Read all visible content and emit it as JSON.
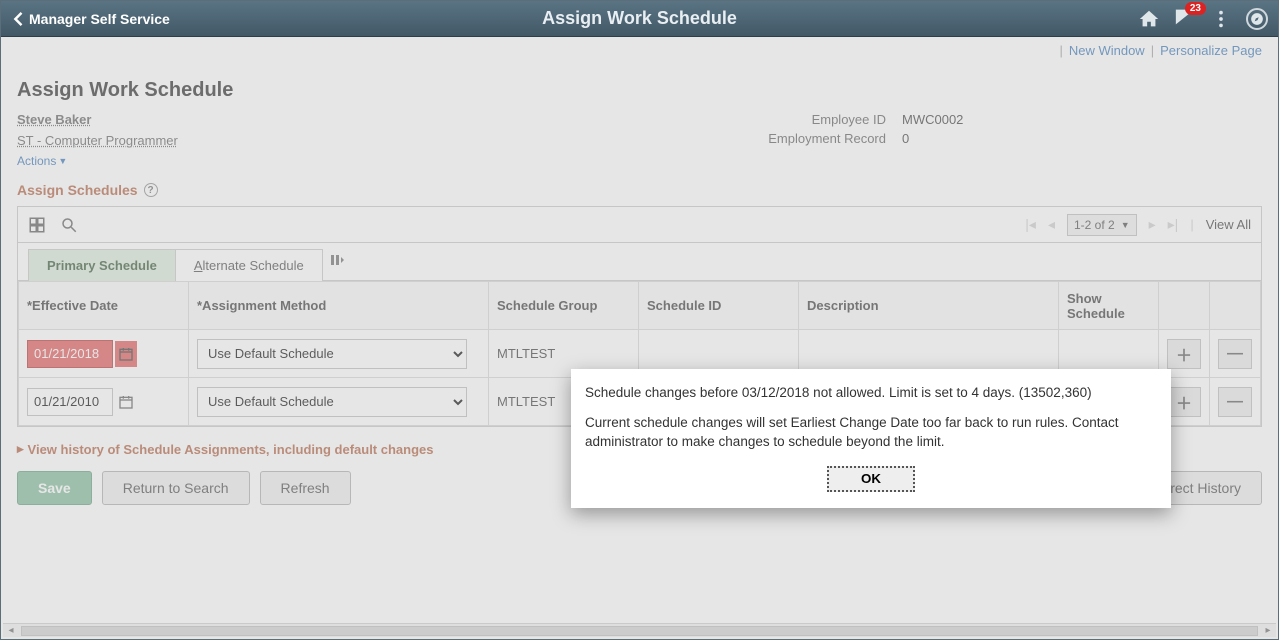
{
  "banner": {
    "back_label": "Manager Self Service",
    "title": "Assign Work Schedule",
    "notif_count": "23"
  },
  "top_links": {
    "new_window": "New Window",
    "personalize": "Personalize Page"
  },
  "page": {
    "title": "Assign Work Schedule",
    "employee_name": "Steve Baker",
    "employee_role": "ST - Computer Programmer",
    "actions_label": "Actions",
    "emp_id_label": "Employee ID",
    "emp_id_value": "MWC0002",
    "emp_rec_label": "Employment Record",
    "emp_rec_value": "0"
  },
  "section": {
    "title": "Assign Schedules",
    "pager_text": "1-2 of 2",
    "view_all": "View All",
    "tabs": {
      "primary": "Primary Schedule",
      "alternate": "Alternate Schedule"
    },
    "columns": {
      "effdt": "*Effective Date",
      "method": "*Assignment Method",
      "group": "Schedule Group",
      "schedid": "Schedule ID",
      "descr": "Description",
      "show": "Show Schedule"
    },
    "rows": [
      {
        "effdt": "01/21/2018",
        "method": "Use Default Schedule",
        "group": "MTLTEST",
        "error": true
      },
      {
        "effdt": "01/21/2010",
        "method": "Use Default Schedule",
        "group": "MTLTEST",
        "error": false
      }
    ],
    "view_history": "View history of Schedule Assignments, including default changes",
    "buttons": {
      "save": "Save",
      "return": "Return to Search",
      "refresh": "Refresh",
      "correct": "Correct History"
    }
  },
  "modal": {
    "line1": "Schedule changes before 03/12/2018  not allowed. Limit is set to 4 days. (13502,360)",
    "line2": "Current schedule changes will set Earliest Change Date too far back to run rules. Contact administrator to make changes to schedule beyond the limit.",
    "ok": "OK"
  }
}
